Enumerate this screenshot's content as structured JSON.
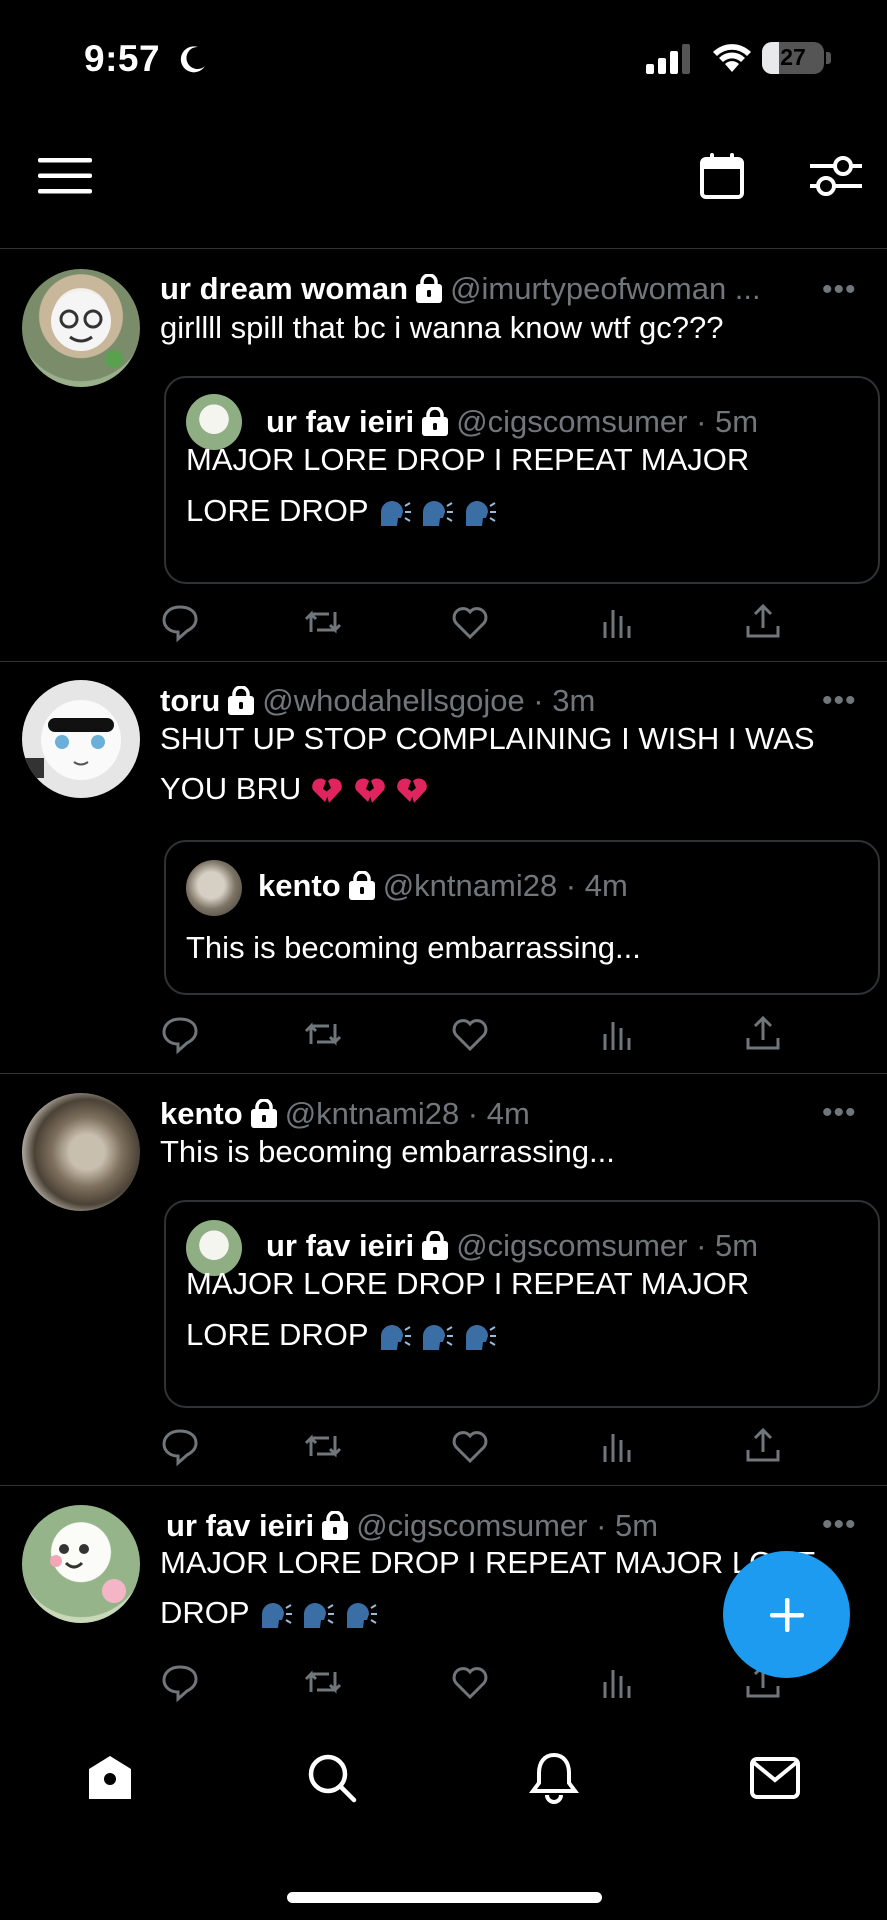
{
  "status_bar": {
    "time": "9:57",
    "battery": "27",
    "battery_level": 0.27
  },
  "toolbar": {
    "menu_icon": "hamburger-menu-icon",
    "calendar_icon": "calendar-icon",
    "filter_icon": "sliders-icon"
  },
  "tweets": [
    {
      "name": "ur dream woman",
      "handle": "@imurtypeofwoman ...",
      "text": "girllll spill that bc i wanna know wtf gc???",
      "quote": {
        "name": "ur fav ieiri",
        "handle_time": "@cigscomsumer · 5m",
        "line1": "MAJOR LORE DROP I REPEAT MAJOR",
        "line2": "LORE DROP"
      }
    },
    {
      "name": "toru",
      "handle": "@whodahellsgojoe · 3m",
      "line1": "SHUT UP STOP COMPLAINING I WISH I WAS",
      "line2": "YOU BRU",
      "quote": {
        "name": "kento",
        "handle_time": "@kntnami28 · 4m",
        "line1": "This is becoming embarrassing..."
      }
    },
    {
      "name": "kento",
      "handle": "@kntnami28 · 4m",
      "text": "This is becoming embarrassing...",
      "quote": {
        "name": "ur fav ieiri",
        "handle_time": "@cigscomsumer · 5m",
        "line1": "MAJOR LORE DROP I REPEAT MAJOR",
        "line2": "LORE DROP"
      }
    },
    {
      "name": "ur fav ieiri",
      "handle": "@cigscomsumer · 5m",
      "line1": "MAJOR LORE DROP I REPEAT MAJOR LORE",
      "line2": "DROP"
    }
  ],
  "more_label": "•••",
  "compose_icon": "plus-icon",
  "tabs": [
    "home-icon",
    "search-icon",
    "bell-icon",
    "mail-icon"
  ],
  "colors": {
    "accent": "#1d9bf0",
    "background": "#000000",
    "divider": "#2f3336",
    "secondary_text": "#71767b"
  }
}
